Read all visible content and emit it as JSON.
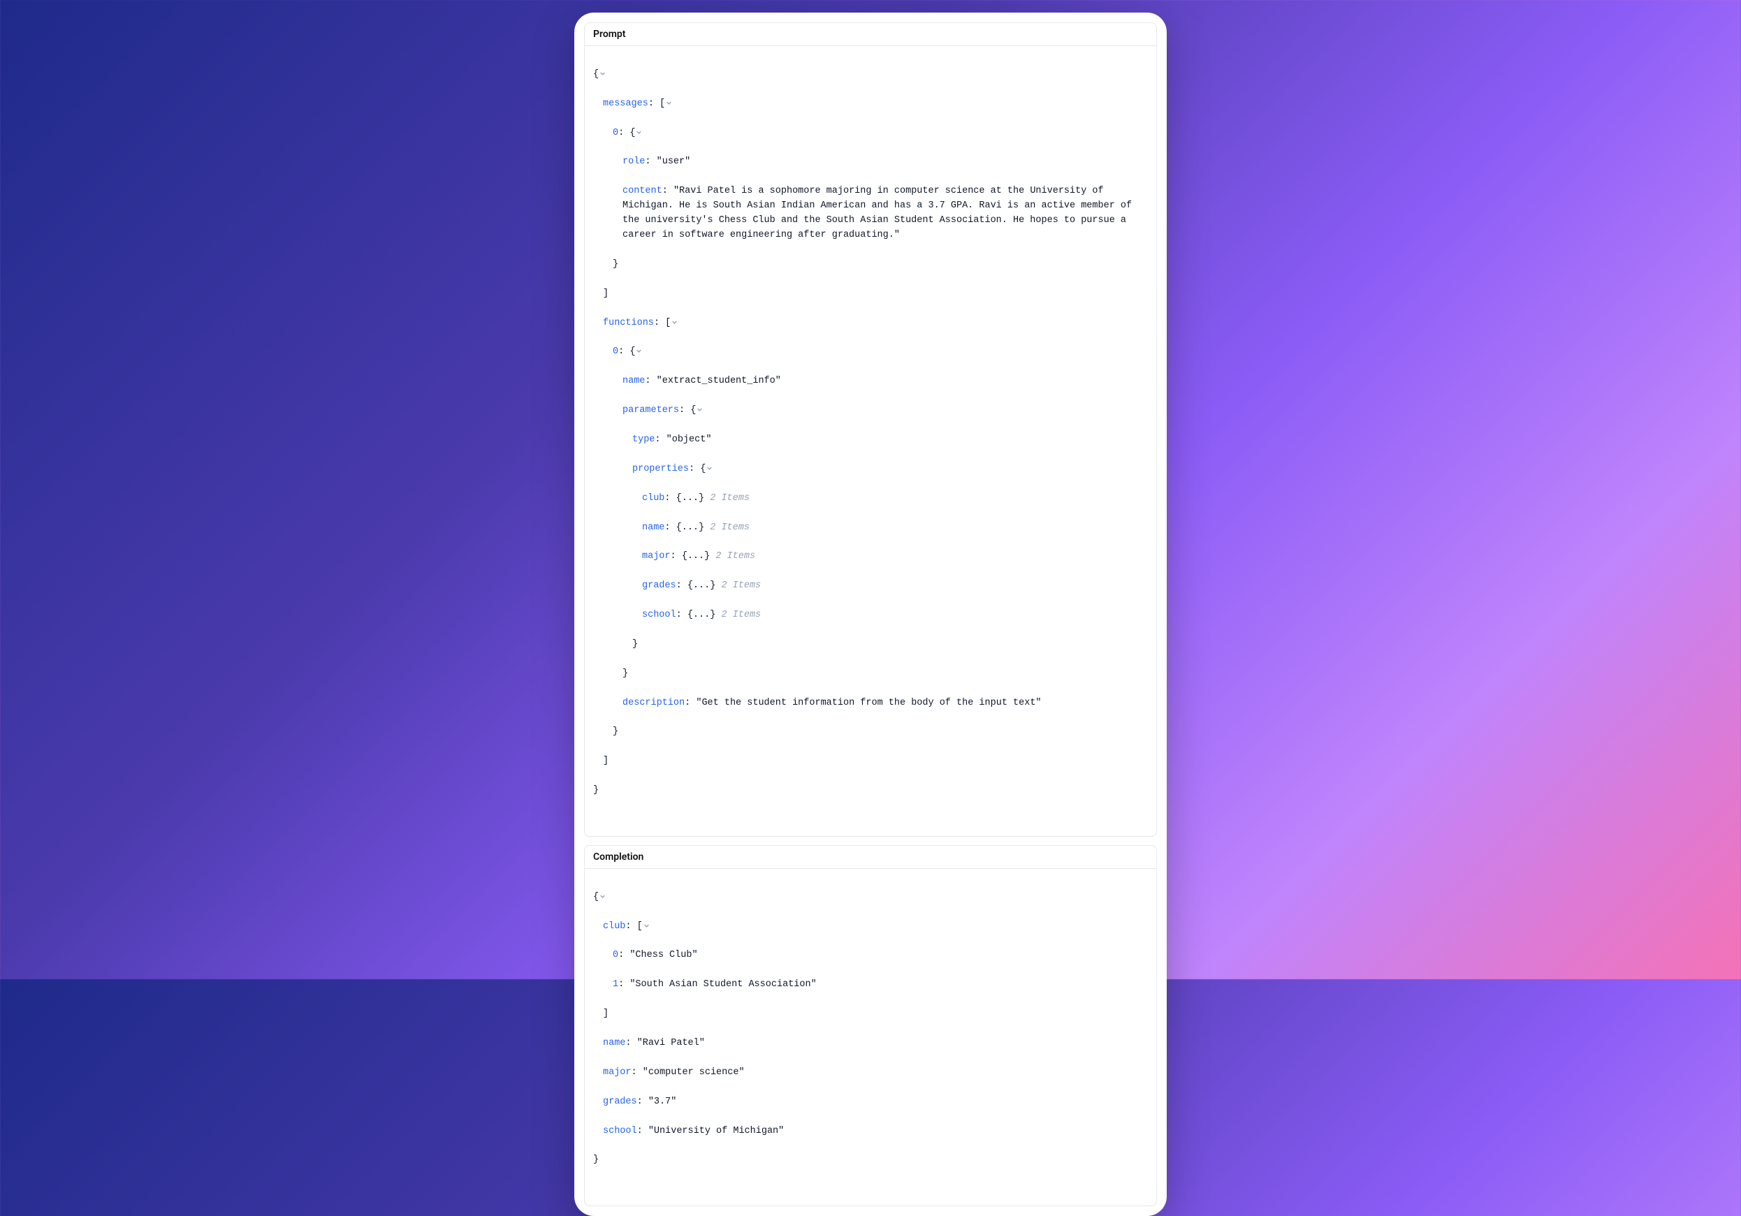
{
  "sections": {
    "prompt_title": "Prompt",
    "completion_title": "Completion"
  },
  "prompt": {
    "messages_key": "messages",
    "msg_index": "0",
    "role_key": "role",
    "role_value": "\"user\"",
    "content_key": "content",
    "content_value": "\"Ravi Patel is a sophomore majoring in computer science at the University of Michigan. He is South Asian Indian American and has a 3.7 GPA. Ravi is an active member of the university's Chess Club and the South Asian Student Association. He hopes to pursue a career in software engineering after graduating.\"",
    "functions_key": "functions",
    "fn_index": "0",
    "name_key": "name",
    "name_value": "\"extract_student_info\"",
    "parameters_key": "parameters",
    "type_key": "type",
    "type_value": "\"object\"",
    "properties_key": "properties",
    "prop_club": "club",
    "prop_name": "name",
    "prop_major": "major",
    "prop_grades": "grades",
    "prop_school": "school",
    "collapsed_placeholder": "{...}",
    "items_count": "2 Items",
    "description_key": "description",
    "description_value": "\"Get the student information from the body of the input text\""
  },
  "completion": {
    "club_key": "club",
    "club_index0": "0",
    "club_value0": "\"Chess Club\"",
    "club_index1": "1",
    "club_value1": "\"South Asian Student Association\"",
    "name_key": "name",
    "name_value": "\"Ravi Patel\"",
    "major_key": "major",
    "major_value": "\"computer science\"",
    "grades_key": "grades",
    "grades_value": "\"3.7\"",
    "school_key": "school",
    "school_value": "\"University of Michigan\""
  },
  "glyphs": {
    "open_brace": "{",
    "close_brace": "}",
    "open_bracket": "[",
    "close_bracket": "]",
    "colon": ":"
  }
}
